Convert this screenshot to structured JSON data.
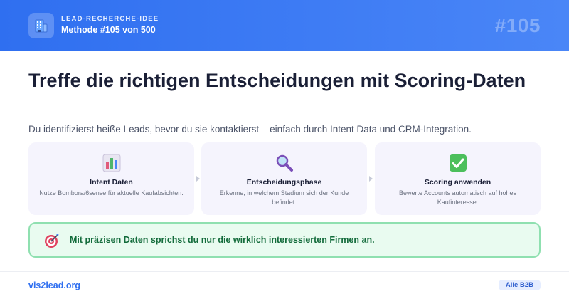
{
  "colors": {
    "header_start": "#2f6ff0",
    "header_end": "#4a86f7",
    "accent": "#2f6ff0",
    "step_bg": "#f5f4fd",
    "callout_bg": "#e9fbf0",
    "callout_border": "#8fe0b0",
    "callout_text": "#146c3c"
  },
  "header": {
    "icon": "building-icon",
    "kicker": "LEAD-RECHERCHE-IDEE",
    "title": "Methode #105 von 500",
    "number": "#105"
  },
  "main": {
    "headline": "Treffe die richtigen Entscheidungen mit Scoring-Daten",
    "subtitle": "Du identifizierst heiße Leads, bevor du sie kontaktierst – einfach durch Intent Data und CRM-Integration.",
    "steps": [
      {
        "icon": "bar-chart-icon",
        "title": "Intent Daten",
        "description": "Nutze Bombora/6sense für aktuelle Kaufabsichten."
      },
      {
        "icon": "magnifier-icon",
        "title": "Entscheidungsphase",
        "description": "Erkenne, in welchem Stadium sich der Kunde befindet."
      },
      {
        "icon": "checkmark-icon",
        "title": "Scoring anwenden",
        "description": "Bewerte Accounts automatisch auf hohes Kaufinteresse."
      }
    ],
    "callout": {
      "icon": "target-icon",
      "text": "Mit präzisen Daten sprichst du nur die wirklich interessierten Firmen an."
    }
  },
  "footer": {
    "link": "vis2lead.org",
    "badge": "Alle B2B"
  }
}
